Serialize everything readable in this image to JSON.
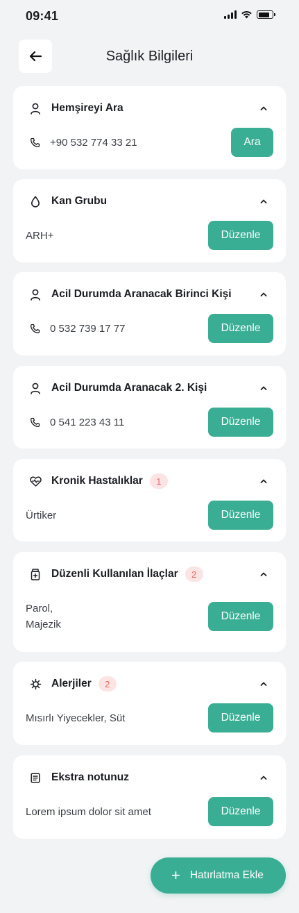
{
  "status_bar": {
    "time": "09:41"
  },
  "header": {
    "title": "Sağlık Bilgileri"
  },
  "cards": [
    {
      "title": "Hemşireyi Ara",
      "value": "+90 532 774 33 21",
      "button": "Ara"
    },
    {
      "title": "Kan Grubu",
      "value": "ARH+",
      "button": "Düzenle"
    },
    {
      "title": "Acil Durumda Aranacak Birinci Kişi",
      "value": "0 532 739 17 77",
      "button": "Düzenle"
    },
    {
      "title": "Acil Durumda Aranacak 2. Kişi",
      "value": "0 541 223 43 11",
      "button": "Düzenle"
    },
    {
      "title": "Kronik Hastalıklar",
      "badge": "1",
      "value": "Ürtiker",
      "button": "Düzenle"
    },
    {
      "title": "Düzenli Kullanılan İlaçlar",
      "badge": "2",
      "value_line1": "Parol,",
      "value_line2": "Majezik",
      "button": "Düzenle"
    },
    {
      "title": "Alerjiler",
      "badge": "2",
      "value": "Mısırlı Yiyecekler, Süt",
      "button": "Düzenle"
    },
    {
      "title": "Ekstra notunuz",
      "value": "Lorem ipsum dolor sit amet",
      "button": "Düzenle"
    }
  ],
  "fab": {
    "label": "Hatırlatma Ekle"
  },
  "colors": {
    "accent": "#3aae94",
    "badge_bg": "#fde4e4",
    "badge_text": "#e46a6a",
    "background": "#f2f3f5"
  }
}
